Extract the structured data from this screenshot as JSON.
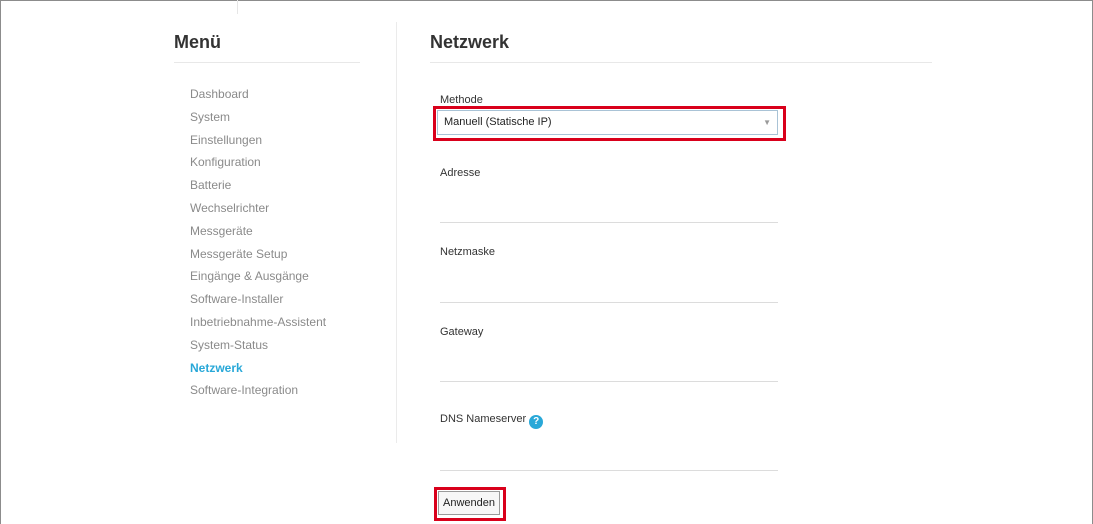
{
  "sidebar": {
    "title": "Menü",
    "items": [
      {
        "label": "Dashboard",
        "active": false
      },
      {
        "label": "System",
        "active": false
      },
      {
        "label": "Einstellungen",
        "active": false
      },
      {
        "label": "Konfiguration",
        "active": false
      },
      {
        "label": "Batterie",
        "active": false
      },
      {
        "label": "Wechselrichter",
        "active": false
      },
      {
        "label": "Messgeräte",
        "active": false
      },
      {
        "label": "Messgeräte Setup",
        "active": false
      },
      {
        "label": "Eingänge & Ausgänge",
        "active": false
      },
      {
        "label": "Software-Installer",
        "active": false
      },
      {
        "label": "Inbetriebnahme-Assistent",
        "active": false
      },
      {
        "label": "System-Status",
        "active": false
      },
      {
        "label": "Netzwerk",
        "active": true
      },
      {
        "label": "Software-Integration",
        "active": false
      }
    ]
  },
  "main": {
    "title": "Netzwerk",
    "method": {
      "label": "Methode",
      "selected": "Manuell (Statische IP)",
      "arrow_icon": "triangle-down-icon"
    },
    "address": {
      "label": "Adresse",
      "value": ""
    },
    "netmask": {
      "label": "Netzmaske",
      "value": ""
    },
    "gateway": {
      "label": "Gateway",
      "value": ""
    },
    "dns": {
      "label": "DNS Nameserver",
      "value": "",
      "help_icon": "question-circle-icon",
      "help_glyph": "?"
    },
    "apply_label": "Anwenden"
  },
  "colors": {
    "accent": "#29a8d8",
    "highlight": "#d9001b",
    "menu_text": "#8a8a8a",
    "heading_text": "#333333"
  }
}
